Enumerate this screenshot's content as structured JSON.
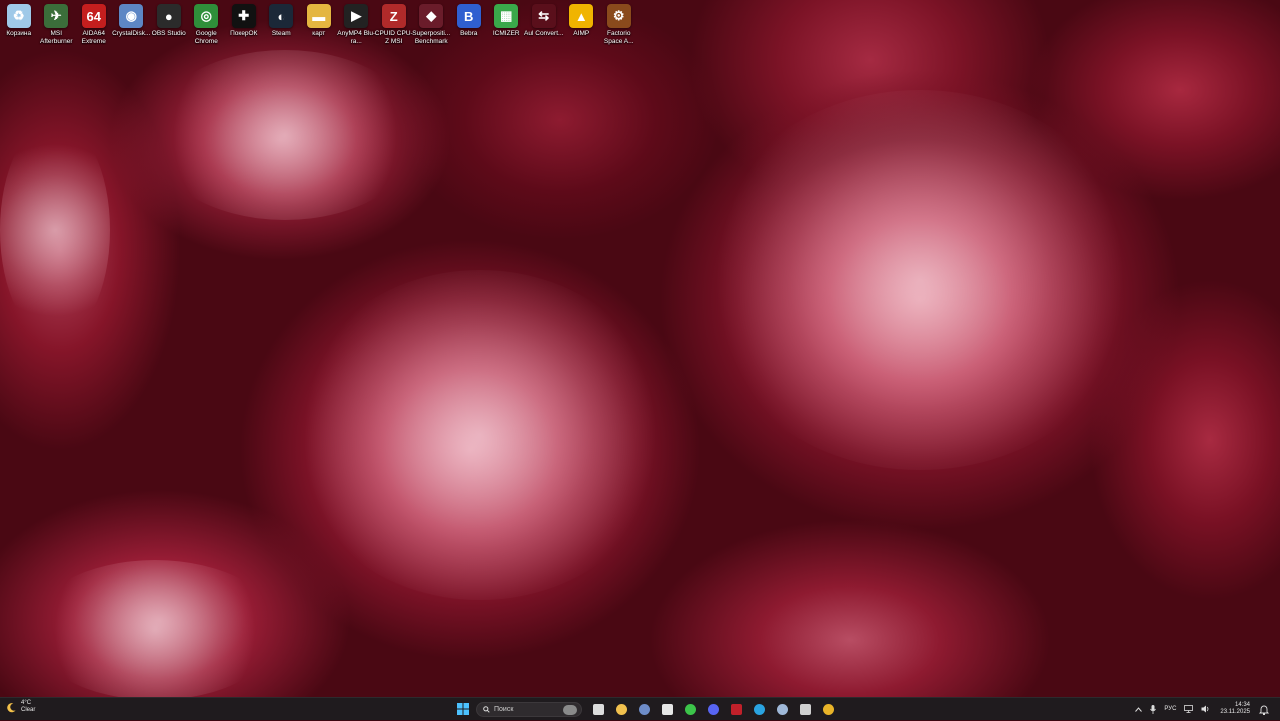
{
  "desktop": {
    "icons": [
      {
        "label": "Корзина",
        "icon": "recycle-bin-icon",
        "color": "#9fc9e8"
      },
      {
        "label": "MSI Afterburner",
        "icon": "msi-afterburner-icon",
        "color": "#3b6e3a"
      },
      {
        "label": "AIDA64 Extreme",
        "icon": "aida64-icon",
        "color": "#c41e1e"
      },
      {
        "label": "CrystalDisk...",
        "icon": "crystaldisk-icon",
        "color": "#5d86c4"
      },
      {
        "label": "OBS Studio",
        "icon": "obs-icon",
        "color": "#2b2b2b"
      },
      {
        "label": "Google Chrome",
        "icon": "chrome-icon",
        "color": "#2f8f3a"
      },
      {
        "label": "ПокерОК",
        "icon": "pokerok-icon",
        "color": "#111111"
      },
      {
        "label": "Steam",
        "icon": "steam-icon",
        "color": "#1b2838"
      },
      {
        "label": "карт",
        "icon": "folder-icon",
        "color": "#e4b640"
      },
      {
        "label": "AnyMP4 Blu-ra...",
        "icon": "anymp4-icon",
        "color": "#222222"
      },
      {
        "label": "CPUID CPU-Z MSI",
        "icon": "cpuz-icon",
        "color": "#b02a2a"
      },
      {
        "label": "Superpositi... Benchmark",
        "icon": "superposition-icon",
        "color": "#6a1c2a"
      },
      {
        "label": "Bebra",
        "icon": "bebra-icon",
        "color": "#2f5fd0"
      },
      {
        "label": "ICMIZER",
        "icon": "icmizer-icon",
        "color": "#3aa84a"
      },
      {
        "label": "Aul Convert...",
        "icon": "aul-converter-icon",
        "color": "#5a0f1b"
      },
      {
        "label": "AIMP",
        "icon": "aimp-icon",
        "color": "#f0b400"
      },
      {
        "label": "Factorio Space A...",
        "icon": "factorio-icon",
        "color": "#8a4a1c"
      }
    ]
  },
  "taskbar": {
    "weather": {
      "temp": "4°C",
      "condition": "Clear",
      "icon": "moon-icon"
    },
    "start_icon": "windows-start-icon",
    "search_placeholder": "Поиск",
    "pinned": [
      {
        "name": "task-view",
        "icon": "task-view-icon",
        "color": "#dcdcdc"
      },
      {
        "name": "file-explorer",
        "icon": "folder-icon",
        "color": "#f2c14e"
      },
      {
        "name": "calculator",
        "icon": "calculator-icon",
        "color": "#6e8cc8"
      },
      {
        "name": "clock-app",
        "icon": "clock-icon",
        "color": "#e6e6e6"
      },
      {
        "name": "arrow-app",
        "icon": "green-arrow-icon",
        "color": "#3cc44a"
      },
      {
        "name": "discord",
        "icon": "discord-icon",
        "color": "#5865f2"
      },
      {
        "name": "red-app",
        "icon": "red-circle-icon",
        "color": "#c0202a"
      },
      {
        "name": "telegram",
        "icon": "telegram-icon",
        "color": "#2aa3e0"
      },
      {
        "name": "steam",
        "icon": "steam-icon",
        "color": "#9fb8d8"
      },
      {
        "name": "obs",
        "icon": "obs-icon",
        "color": "#d0d0d0"
      },
      {
        "name": "chrome",
        "icon": "chrome-icon",
        "color": "#e9b429"
      }
    ],
    "tray": {
      "language": "РУС",
      "time": "14:34",
      "date": "23.11.2025"
    }
  }
}
